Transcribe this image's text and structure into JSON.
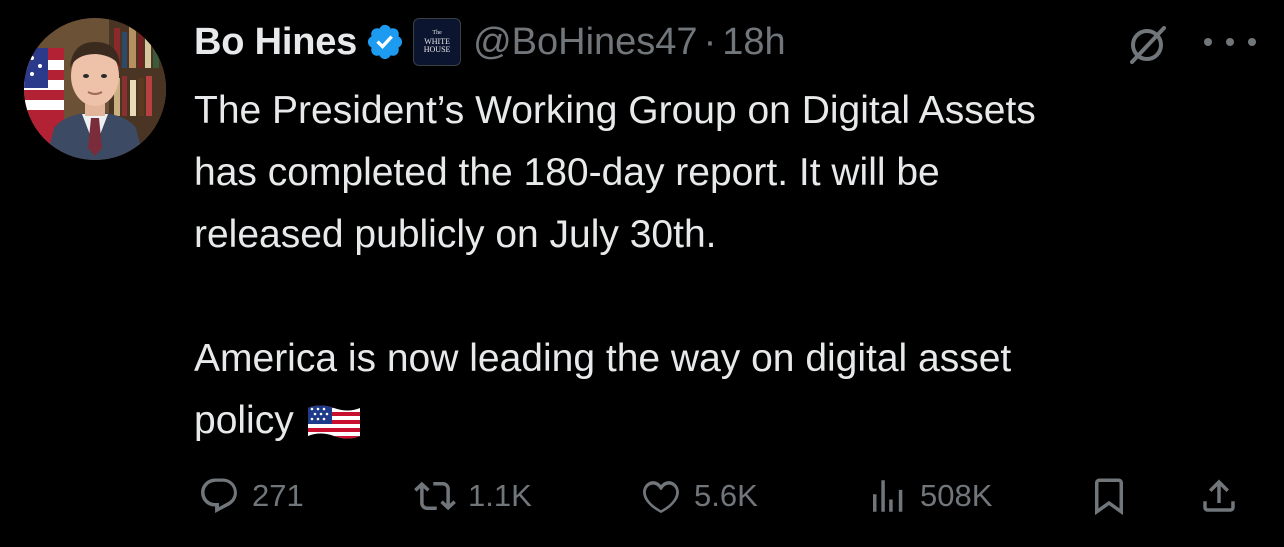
{
  "tweet": {
    "author": {
      "name": "Bo Hines",
      "handle": "@BoHines47",
      "verified_badge_icon": "verified-badge-icon",
      "verified_color": "#1d9bf0",
      "affiliation_badge": {
        "line1": "The",
        "line2": "WHITE",
        "line3": "HOUSE"
      }
    },
    "separator": "·",
    "timestamp": "18h",
    "text": {
      "paragraph1_lines": [
        "The President’s Working Group on Digital Assets",
        "has completed the 180-day report. It will be",
        "released publicly on July 30th."
      ],
      "paragraph2_lines": [
        "America is now leading the way on digital asset",
        "policy"
      ],
      "emoji": "us-flag-emoji"
    },
    "actions": {
      "replies": "271",
      "reposts": "1.1K",
      "likes": "5.6K",
      "views": "508K"
    },
    "icons": {
      "grok": "grok-icon",
      "more": "more-icon",
      "reply": "reply-icon",
      "repost": "repost-icon",
      "like": "heart-icon",
      "views": "views-icon",
      "bookmark": "bookmark-icon",
      "share": "share-icon"
    },
    "colors": {
      "background": "#000000",
      "text": "#e7e9ea",
      "secondary": "#71767b",
      "accent": "#1d9bf0"
    }
  }
}
